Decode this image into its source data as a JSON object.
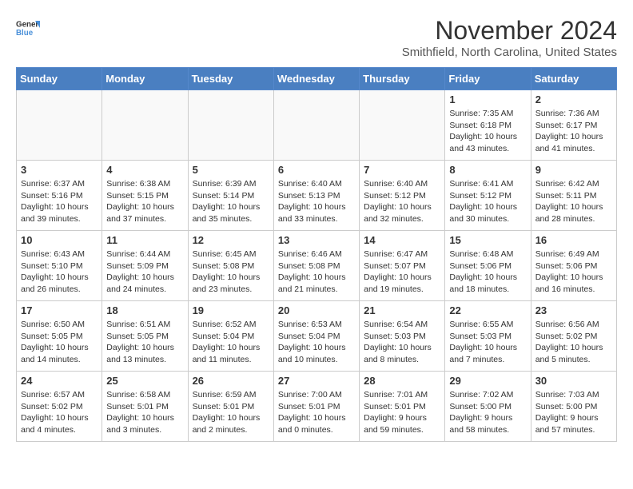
{
  "logo": {
    "line1": "General",
    "line2": "Blue"
  },
  "title": "November 2024",
  "location": "Smithfield, North Carolina, United States",
  "header": {
    "days": [
      "Sunday",
      "Monday",
      "Tuesday",
      "Wednesday",
      "Thursday",
      "Friday",
      "Saturday"
    ]
  },
  "weeks": [
    [
      {
        "day": "",
        "info": ""
      },
      {
        "day": "",
        "info": ""
      },
      {
        "day": "",
        "info": ""
      },
      {
        "day": "",
        "info": ""
      },
      {
        "day": "",
        "info": ""
      },
      {
        "day": "1",
        "info": "Sunrise: 7:35 AM\nSunset: 6:18 PM\nDaylight: 10 hours and 43 minutes."
      },
      {
        "day": "2",
        "info": "Sunrise: 7:36 AM\nSunset: 6:17 PM\nDaylight: 10 hours and 41 minutes."
      }
    ],
    [
      {
        "day": "3",
        "info": "Sunrise: 6:37 AM\nSunset: 5:16 PM\nDaylight: 10 hours and 39 minutes."
      },
      {
        "day": "4",
        "info": "Sunrise: 6:38 AM\nSunset: 5:15 PM\nDaylight: 10 hours and 37 minutes."
      },
      {
        "day": "5",
        "info": "Sunrise: 6:39 AM\nSunset: 5:14 PM\nDaylight: 10 hours and 35 minutes."
      },
      {
        "day": "6",
        "info": "Sunrise: 6:40 AM\nSunset: 5:13 PM\nDaylight: 10 hours and 33 minutes."
      },
      {
        "day": "7",
        "info": "Sunrise: 6:40 AM\nSunset: 5:12 PM\nDaylight: 10 hours and 32 minutes."
      },
      {
        "day": "8",
        "info": "Sunrise: 6:41 AM\nSunset: 5:12 PM\nDaylight: 10 hours and 30 minutes."
      },
      {
        "day": "9",
        "info": "Sunrise: 6:42 AM\nSunset: 5:11 PM\nDaylight: 10 hours and 28 minutes."
      }
    ],
    [
      {
        "day": "10",
        "info": "Sunrise: 6:43 AM\nSunset: 5:10 PM\nDaylight: 10 hours and 26 minutes."
      },
      {
        "day": "11",
        "info": "Sunrise: 6:44 AM\nSunset: 5:09 PM\nDaylight: 10 hours and 24 minutes."
      },
      {
        "day": "12",
        "info": "Sunrise: 6:45 AM\nSunset: 5:08 PM\nDaylight: 10 hours and 23 minutes."
      },
      {
        "day": "13",
        "info": "Sunrise: 6:46 AM\nSunset: 5:08 PM\nDaylight: 10 hours and 21 minutes."
      },
      {
        "day": "14",
        "info": "Sunrise: 6:47 AM\nSunset: 5:07 PM\nDaylight: 10 hours and 19 minutes."
      },
      {
        "day": "15",
        "info": "Sunrise: 6:48 AM\nSunset: 5:06 PM\nDaylight: 10 hours and 18 minutes."
      },
      {
        "day": "16",
        "info": "Sunrise: 6:49 AM\nSunset: 5:06 PM\nDaylight: 10 hours and 16 minutes."
      }
    ],
    [
      {
        "day": "17",
        "info": "Sunrise: 6:50 AM\nSunset: 5:05 PM\nDaylight: 10 hours and 14 minutes."
      },
      {
        "day": "18",
        "info": "Sunrise: 6:51 AM\nSunset: 5:05 PM\nDaylight: 10 hours and 13 minutes."
      },
      {
        "day": "19",
        "info": "Sunrise: 6:52 AM\nSunset: 5:04 PM\nDaylight: 10 hours and 11 minutes."
      },
      {
        "day": "20",
        "info": "Sunrise: 6:53 AM\nSunset: 5:04 PM\nDaylight: 10 hours and 10 minutes."
      },
      {
        "day": "21",
        "info": "Sunrise: 6:54 AM\nSunset: 5:03 PM\nDaylight: 10 hours and 8 minutes."
      },
      {
        "day": "22",
        "info": "Sunrise: 6:55 AM\nSunset: 5:03 PM\nDaylight: 10 hours and 7 minutes."
      },
      {
        "day": "23",
        "info": "Sunrise: 6:56 AM\nSunset: 5:02 PM\nDaylight: 10 hours and 5 minutes."
      }
    ],
    [
      {
        "day": "24",
        "info": "Sunrise: 6:57 AM\nSunset: 5:02 PM\nDaylight: 10 hours and 4 minutes."
      },
      {
        "day": "25",
        "info": "Sunrise: 6:58 AM\nSunset: 5:01 PM\nDaylight: 10 hours and 3 minutes."
      },
      {
        "day": "26",
        "info": "Sunrise: 6:59 AM\nSunset: 5:01 PM\nDaylight: 10 hours and 2 minutes."
      },
      {
        "day": "27",
        "info": "Sunrise: 7:00 AM\nSunset: 5:01 PM\nDaylight: 10 hours and 0 minutes."
      },
      {
        "day": "28",
        "info": "Sunrise: 7:01 AM\nSunset: 5:01 PM\nDaylight: 9 hours and 59 minutes."
      },
      {
        "day": "29",
        "info": "Sunrise: 7:02 AM\nSunset: 5:00 PM\nDaylight: 9 hours and 58 minutes."
      },
      {
        "day": "30",
        "info": "Sunrise: 7:03 AM\nSunset: 5:00 PM\nDaylight: 9 hours and 57 minutes."
      }
    ]
  ]
}
